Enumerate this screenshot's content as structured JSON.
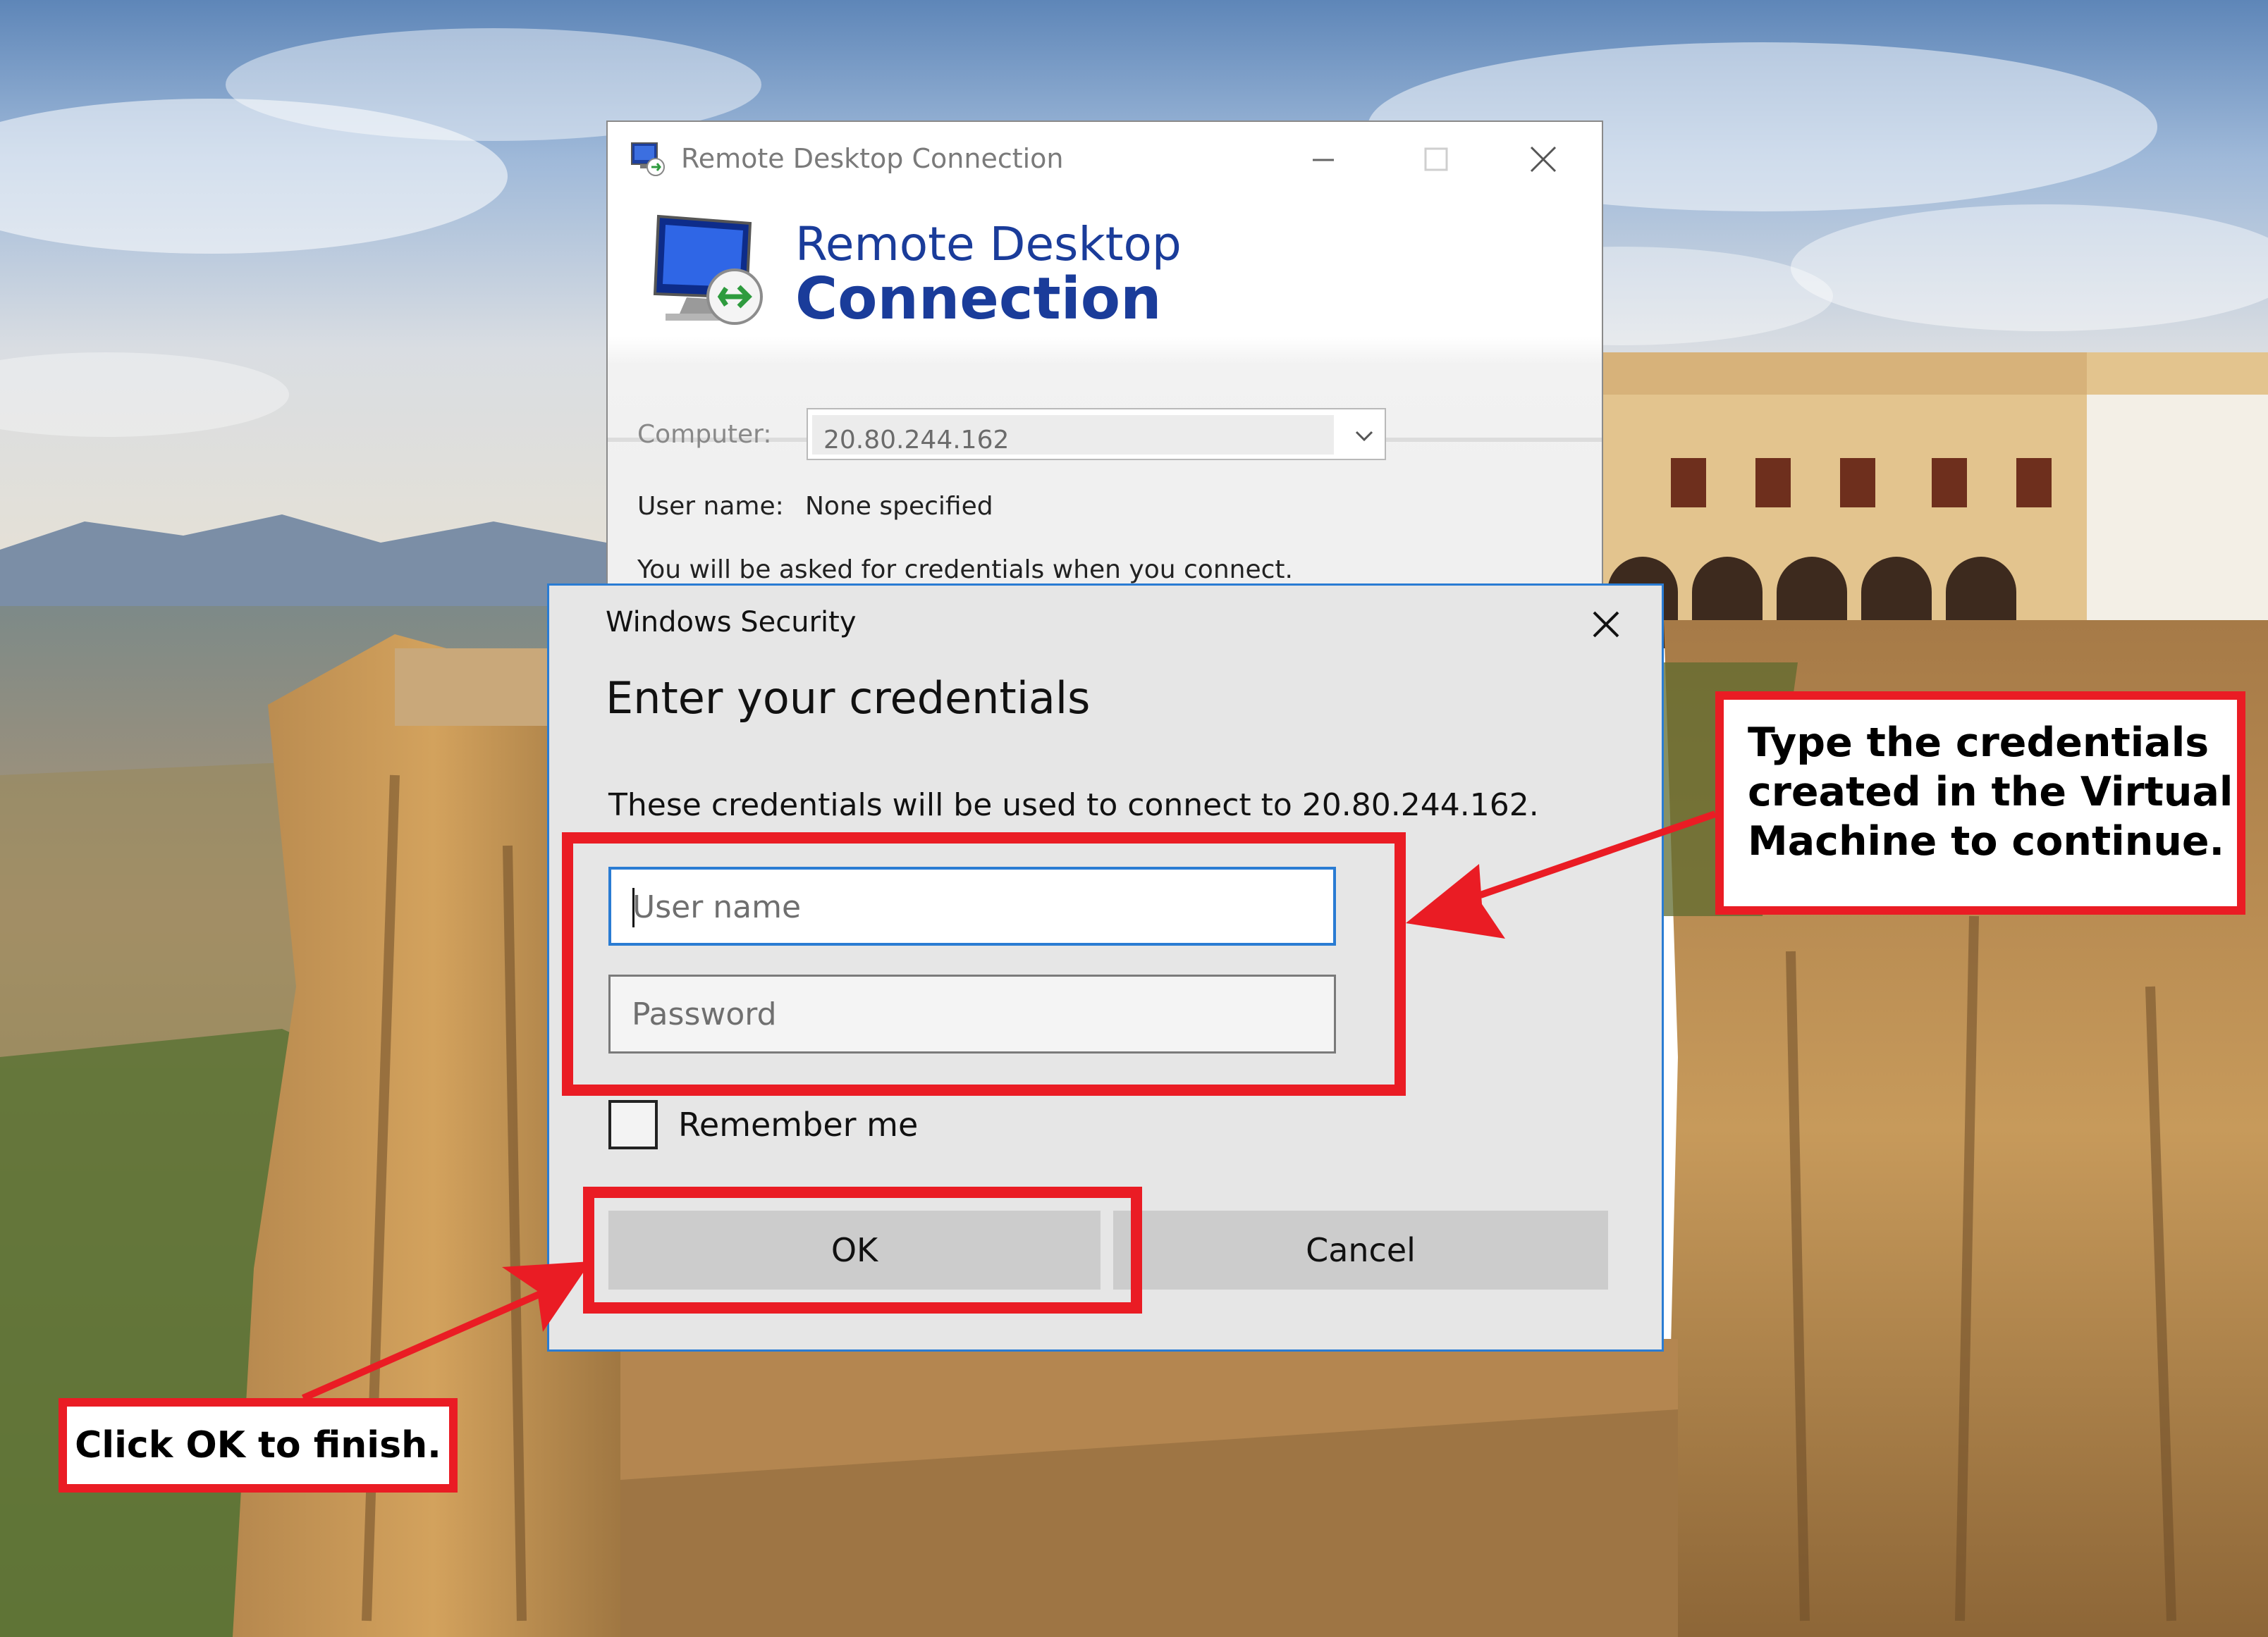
{
  "rdc_window": {
    "title": "Remote Desktop Connection",
    "banner_line1": "Remote Desktop",
    "banner_line2": "Connection",
    "computer_label": "Computer:",
    "computer_value": "20.80.244.162",
    "username_label": "User name:",
    "username_value": "None specified",
    "info_text": "You will be asked for credentials when you connect."
  },
  "security_dialog": {
    "title": "Windows Security",
    "heading": "Enter your credentials",
    "description": "These credentials will be used to connect to 20.80.244.162.",
    "username_placeholder": "User name",
    "password_placeholder": "Password",
    "remember_label": "Remember me",
    "remember_checked": false,
    "ok_label": "OK",
    "cancel_label": "Cancel",
    "accent_color": "#2a7cd3"
  },
  "annotations": {
    "credentials_callout": {
      "line1": "Type the credentials",
      "line2": "created in the Virtual",
      "line3": "Machine to continue."
    },
    "ok_callout": "Click OK to finish.",
    "highlight_color": "#ea1c24"
  },
  "icons": {
    "rdc_app": "remote-desktop-icon",
    "rdc_banner": "monitor-connection-icon",
    "minimize": "minimize-icon",
    "maximize": "maximize-icon",
    "close": "close-icon",
    "dropdown": "chevron-down-icon"
  }
}
